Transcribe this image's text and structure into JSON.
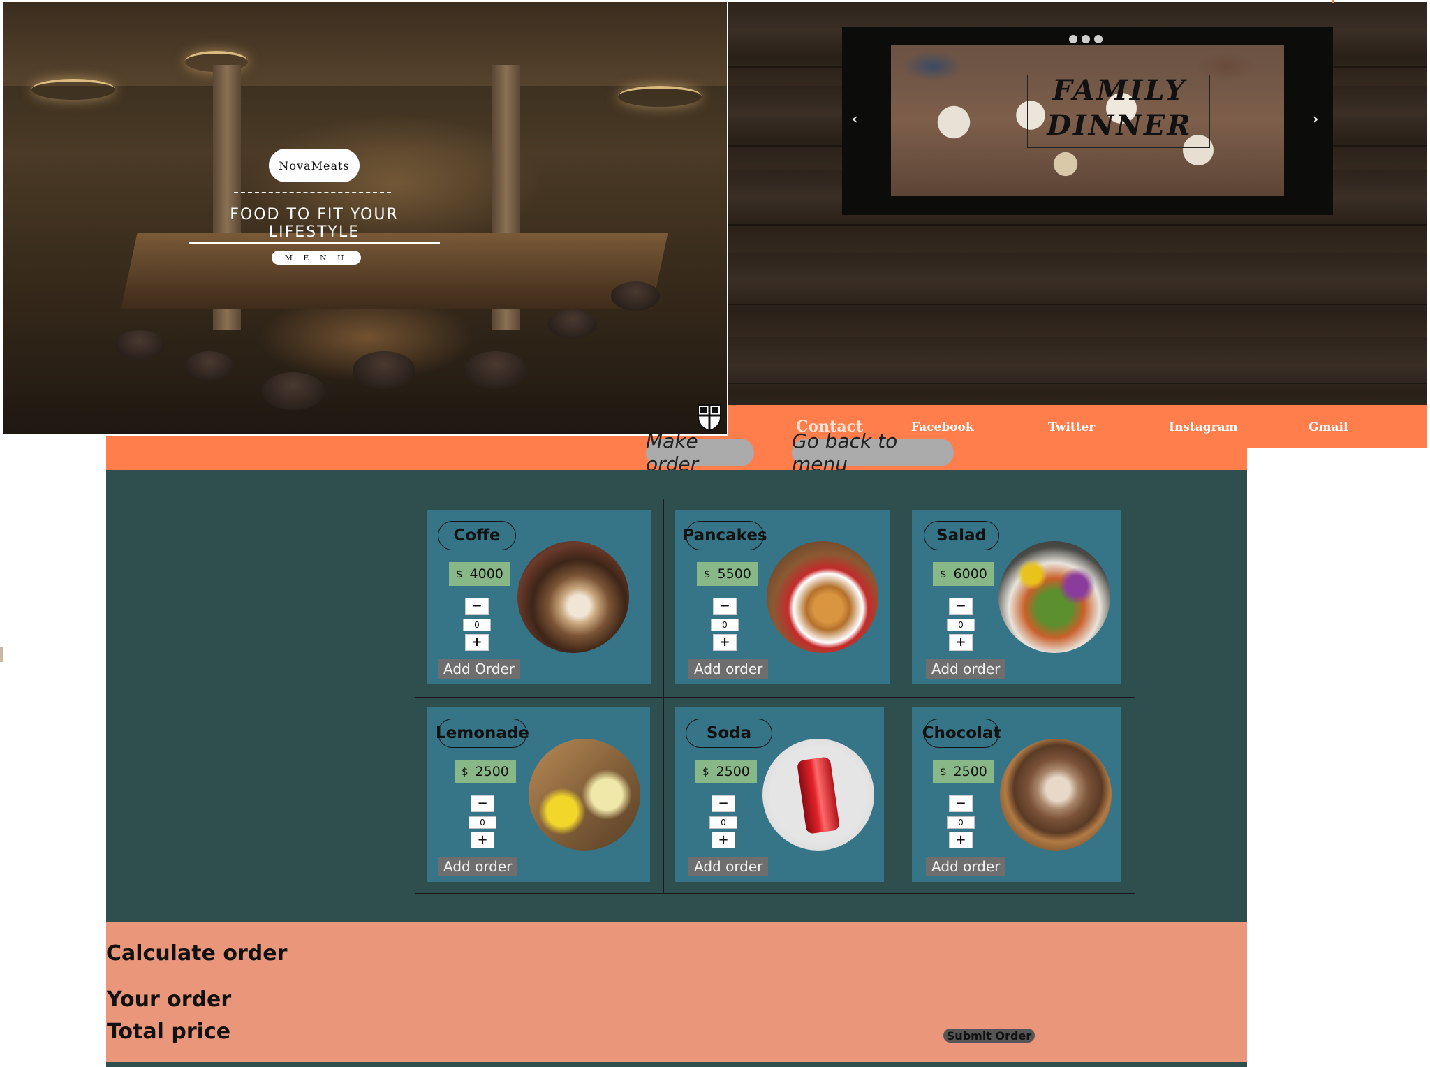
{
  "hero": {
    "brand": "NovaMeats",
    "tagline": "FOOD TO FIT YOUR LIFESTYLE",
    "menu_button": "M E N U",
    "shield_icon": "shield-icon"
  },
  "carousel": {
    "slide_title_line1": "FAMILY",
    "slide_title_line2": "DINNER",
    "prev_icon": "‹",
    "next_icon": "›"
  },
  "social": {
    "contact": "Contact",
    "links": [
      "Facebook",
      "Twitter",
      "Instagram",
      "Gmail"
    ]
  },
  "nav": {
    "make_order": "Make order",
    "go_back": "Go back to menu"
  },
  "products": [
    {
      "name": "Coffe",
      "currency": "$",
      "price": "4000",
      "qty": "0",
      "minus": "−",
      "plus": "+",
      "add": "Add Order",
      "image": "coffee-photo"
    },
    {
      "name": "Pancakes",
      "currency": "$",
      "price": "5500",
      "qty": "0",
      "minus": "−",
      "plus": "+",
      "add": "Add order",
      "image": "pancakes-photo"
    },
    {
      "name": "Salad",
      "currency": "$",
      "price": "6000",
      "qty": "0",
      "minus": "−",
      "plus": "+",
      "add": "Add order",
      "image": "salad-photo"
    },
    {
      "name": "Lemonade",
      "currency": "$",
      "price": "2500",
      "qty": "0",
      "minus": "−",
      "plus": "+",
      "add": "Add order",
      "image": "lemonade-photo"
    },
    {
      "name": "Soda",
      "currency": "$",
      "price": "2500",
      "qty": "0",
      "minus": "−",
      "plus": "+",
      "add": "Add order",
      "image": "soda-photo"
    },
    {
      "name": "Chocolat",
      "currency": "$",
      "price": "2500",
      "qty": "0",
      "minus": "−",
      "plus": "+",
      "add": "Add order",
      "image": "chocolat-photo"
    }
  ],
  "calculate": {
    "heading": "Calculate order",
    "your_order": "Your order",
    "total_price": "Total price",
    "submit": "Submit Order"
  },
  "colors": {
    "orange": "#ff7e4b",
    "teal_bg": "#2f4f4f",
    "card": "#367588",
    "price_bg": "#88b888",
    "salmon": "#e9967a"
  }
}
